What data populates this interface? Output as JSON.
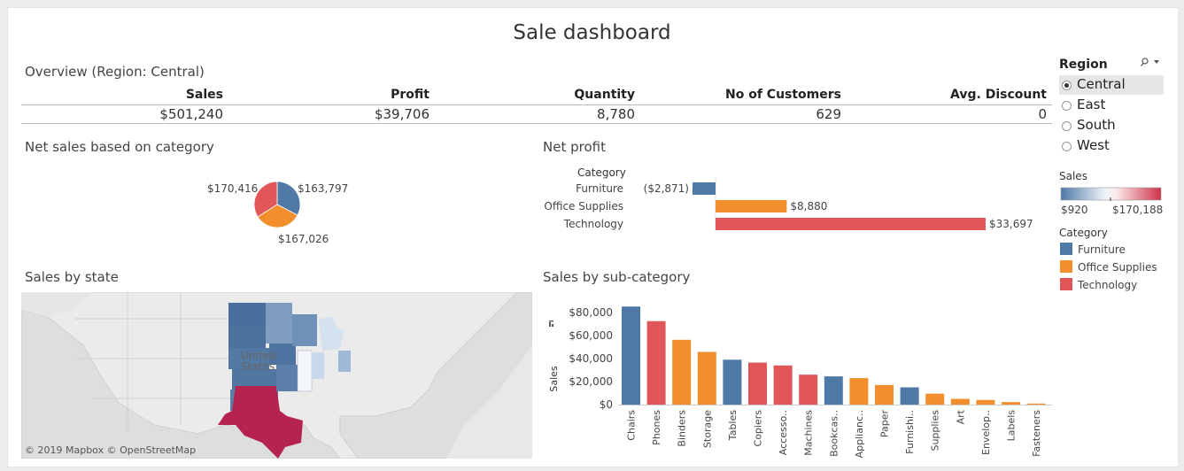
{
  "dashboard": {
    "title": "Sale dashboard"
  },
  "overview": {
    "title": "Overview (Region: Central)",
    "headers": [
      "Sales",
      "Profit",
      "Quantity",
      "No of Customers",
      "Avg. Discount"
    ],
    "values": [
      "$501,240",
      "$39,706",
      "8,780",
      "629",
      "0"
    ]
  },
  "net_sales": {
    "title": "Net sales based on category",
    "labels": [
      "$163,797",
      "$167,026",
      "$170,416"
    ]
  },
  "net_profit": {
    "title": "Net profit",
    "header": "Category",
    "rows": [
      {
        "category": "Furniture",
        "label": "($2,871)"
      },
      {
        "category": "Office Supplies",
        "label": "$8,880"
      },
      {
        "category": "Technology",
        "label": "$33,697"
      }
    ]
  },
  "sales_by_state": {
    "title": "Sales by state",
    "map_label_1": "United",
    "map_label_2": "States",
    "attribution": "© 2019 Mapbox  © OpenStreetMap"
  },
  "sales_by_subcategory": {
    "title": "Sales by sub-category",
    "ylabel": "Sales"
  },
  "filters": {
    "region_title": "Region",
    "regions": [
      "Central",
      "East",
      "South",
      "West"
    ],
    "selected_region": "Central",
    "sales_legend_title": "Sales",
    "sales_min": "$920",
    "sales_max": "$170,188",
    "category_legend_title": "Category",
    "categories": [
      "Furniture",
      "Office Supplies",
      "Technology"
    ]
  },
  "colors": {
    "furniture": "#4e79a7",
    "office_supplies": "#f28e2b",
    "technology": "#e15759",
    "map_high": "#b5234f"
  },
  "chart_data": [
    {
      "type": "pie",
      "title": "Net sales based on category",
      "categories": [
        "Furniture",
        "Office Supplies",
        "Technology"
      ],
      "values": [
        163797,
        167026,
        170416
      ]
    },
    {
      "type": "bar",
      "orientation": "horizontal",
      "title": "Net profit",
      "categories": [
        "Furniture",
        "Office Supplies",
        "Technology"
      ],
      "values": [
        -2871,
        8880,
        33697
      ]
    },
    {
      "type": "bar",
      "title": "Sales by sub-category",
      "ylabel": "Sales",
      "ylim": [
        0,
        90000
      ],
      "yticks": [
        "$0",
        "$20,000",
        "$40,000",
        "$60,000",
        "$80,000"
      ],
      "categories": [
        "Chairs",
        "Phones",
        "Binders",
        "Storage",
        "Tables",
        "Copiers",
        "Accesso..",
        "Machines",
        "Bookcas..",
        "Applianc..",
        "Paper",
        "Furnishi..",
        "Supplies",
        "Art",
        "Envelop..",
        "Labels",
        "Fasteners"
      ],
      "values": [
        85200,
        72500,
        56300,
        45800,
        39000,
        36500,
        34000,
        26000,
        24500,
        23000,
        17000,
        15000,
        9500,
        5000,
        4000,
        2200,
        900
      ],
      "category_of": [
        "Furniture",
        "Technology",
        "Office Supplies",
        "Office Supplies",
        "Furniture",
        "Technology",
        "Technology",
        "Technology",
        "Furniture",
        "Office Supplies",
        "Office Supplies",
        "Furniture",
        "Office Supplies",
        "Office Supplies",
        "Office Supplies",
        "Office Supplies",
        "Office Supplies"
      ]
    }
  ]
}
